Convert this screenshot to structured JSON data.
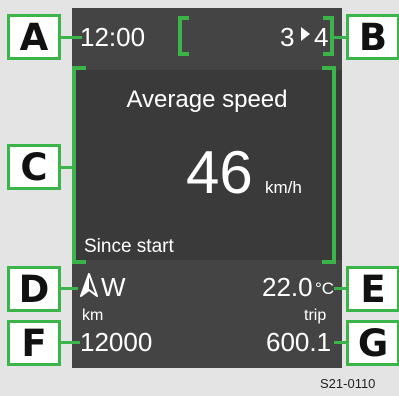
{
  "labels": {
    "a": "A",
    "b": "B",
    "c": "C",
    "d": "D",
    "e": "E",
    "f": "F",
    "g": "G"
  },
  "top_bar": {
    "time": "12:00",
    "gear_from": "3",
    "gear_to": "4"
  },
  "main_screen": {
    "title": "Average speed",
    "value": "46",
    "unit": "km/h",
    "period": "Since start"
  },
  "compass": {
    "icon": "navigation-arrow-icon",
    "direction": "W"
  },
  "temperature": {
    "value": "22.0",
    "unit": "°C"
  },
  "odometer": {
    "label": "km",
    "value": "12000"
  },
  "trip": {
    "label": "trip",
    "value": "600.1"
  },
  "figure_code": "S21-0110",
  "colors": {
    "highlight": "#3bb54a",
    "panel": "#444444",
    "screen": "#3a3a3a",
    "background": "#e4e4e4"
  }
}
